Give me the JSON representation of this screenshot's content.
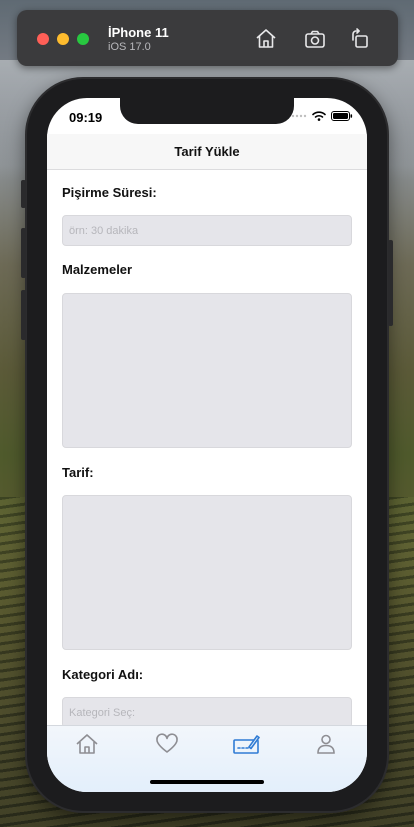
{
  "simulator": {
    "device_name": "İPhone 11",
    "os_version": "iOS 17.0",
    "buttons": [
      "home-icon",
      "screenshot-icon",
      "rotate-icon"
    ]
  },
  "status_bar": {
    "time": "09:19"
  },
  "nav": {
    "title": "Tarif Yükle"
  },
  "form": {
    "cook_time": {
      "label": "Pişirme Süresi:",
      "placeholder": "örn: 30 dakika",
      "value": ""
    },
    "ingredients": {
      "label": "Malzemeler",
      "value": ""
    },
    "recipe": {
      "label": "Tarif:",
      "value": ""
    },
    "category": {
      "label": "Kategori Adı:",
      "placeholder": "Kategori Seç:",
      "value": ""
    }
  },
  "tab_bar": {
    "items": [
      {
        "icon": "house-icon",
        "selected": false
      },
      {
        "icon": "heart-icon",
        "selected": false
      },
      {
        "icon": "signature-icon",
        "selected": true
      },
      {
        "icon": "person-icon",
        "selected": false
      }
    ],
    "selected_color": "#2f7bd4",
    "unselected_color": "#8e8e93"
  }
}
